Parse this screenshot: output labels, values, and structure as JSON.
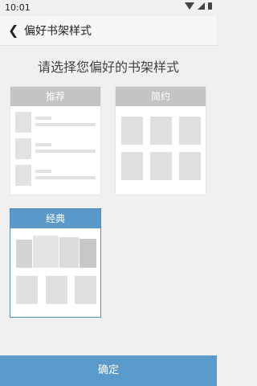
{
  "status_bar": {
    "time": "10:01"
  },
  "app_bar": {
    "title": "偏好书架样式"
  },
  "heading": "请选择您偏好的书架样式",
  "styles": [
    {
      "label": "推荐",
      "selected": false
    },
    {
      "label": "简约",
      "selected": false
    },
    {
      "label": "经典",
      "selected": true
    }
  ],
  "confirm_label": "确定",
  "colors": {
    "accent": "#5a99c9",
    "unselected_header": "#c4c4c4"
  }
}
